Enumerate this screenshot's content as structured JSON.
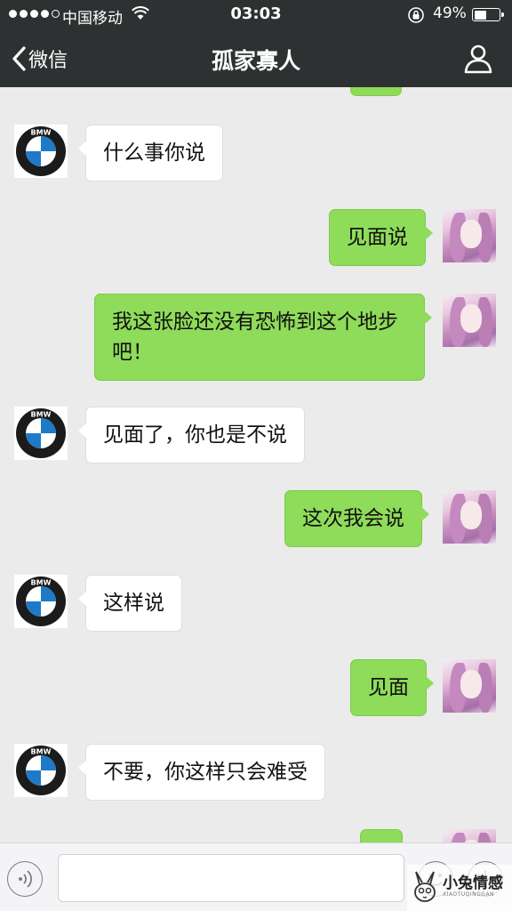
{
  "status_bar": {
    "carrier": "中国移动",
    "time": "03:03",
    "battery": "49%",
    "battery_level": 0.49
  },
  "nav": {
    "back_label": "微信",
    "title": "孤家寡人"
  },
  "messages": [
    {
      "side": "right",
      "sender": "me",
      "text": ""
    },
    {
      "side": "left",
      "sender": "bmw",
      "text": "什么事你说"
    },
    {
      "side": "right",
      "sender": "me",
      "text": "见面说"
    },
    {
      "side": "right",
      "sender": "me",
      "text": "我这张脸还没有恐怖到这个地步吧！"
    },
    {
      "side": "left",
      "sender": "bmw",
      "text": "见面了，你也是不说"
    },
    {
      "side": "right",
      "sender": "me",
      "text": "这次我会说"
    },
    {
      "side": "left",
      "sender": "bmw",
      "text": "这样说"
    },
    {
      "side": "right",
      "sender": "me",
      "text": "见面"
    },
    {
      "side": "left",
      "sender": "bmw",
      "text": "不要，你这样只会难受"
    },
    {
      "side": "right",
      "sender": "me",
      "text": ""
    }
  ],
  "avatar_logo_text": "BMW",
  "input": {
    "value": "",
    "placeholder": ""
  },
  "watermark": {
    "text": "小兔情感",
    "sub": "XIAOTUQINGGAN"
  },
  "colors": {
    "nav_bg": "#2e3132",
    "chat_bg": "#ebebeb",
    "sent_bubble": "#8fdb5a",
    "received_bubble": "#ffffff"
  }
}
